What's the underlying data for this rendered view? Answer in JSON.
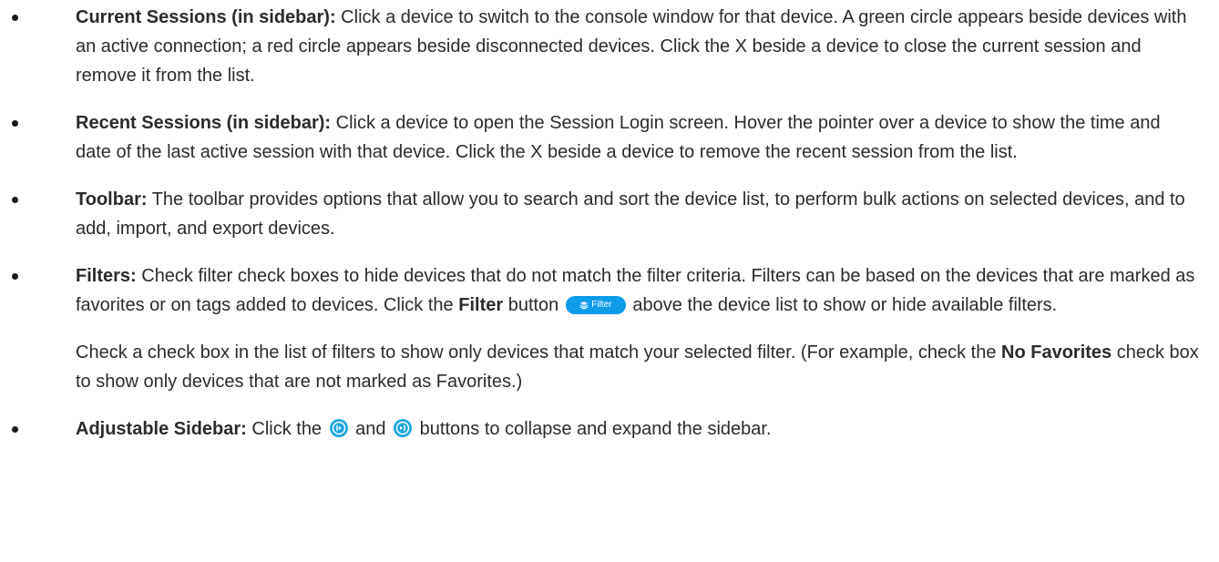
{
  "items": [
    {
      "label": "Current Sessions (in sidebar):",
      "text": " Click a device to switch to the console window for that device. A green circle appears beside devices with an active connection; a red circle appears beside disconnected devices. Click the X beside a device to close the current session and remove it from the list."
    },
    {
      "label": "Recent Sessions (in sidebar):",
      "text": " Click a device to open the Session Login screen. Hover the pointer over a device to show the time and date of the last active session with that device. Click the X beside a device to remove the recent session from the list."
    },
    {
      "label": "Toolbar:",
      "text": " The toolbar provides options that allow you to search and sort the device list, to perform bulk actions on selected devices, and to add, import, and export devices."
    },
    {
      "label": "Filters:",
      "text_1": " Check filter check boxes to hide devices that do not match the filter criteria. Filters can be based on the devices that are marked as favorites or on tags added to devices. Click the ",
      "bold_1": "Filter",
      "text_2": " button ",
      "button_label": "Filter",
      "text_3": " above the device list to show or hide available filters.",
      "sub_text_1": "Check a check box in the list of filters to show only devices that match your selected filter. (For example, check the ",
      "sub_bold": "No Favorites",
      "sub_text_2": " check box to show only devices that are not marked as Favorites.)"
    },
    {
      "label": "Adjustable Sidebar:",
      "text_1": " Click the ",
      "text_2": " and ",
      "text_3": " buttons to collapse and expand the sidebar."
    }
  ],
  "icons": {
    "filter_icon": "layers-icon",
    "collapse_icon": "collapse-sidebar-icon",
    "expand_icon": "expand-sidebar-icon"
  },
  "colors": {
    "accent": "#0e9be8",
    "text": "#2b2b2b"
  }
}
